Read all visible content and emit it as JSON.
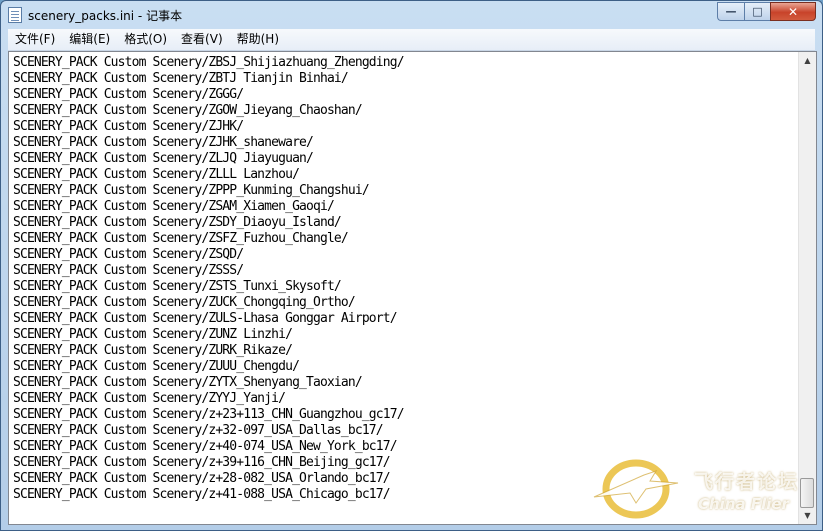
{
  "window": {
    "title": "scenery_packs.ini - 记事本",
    "buttons": {
      "minimize": "—",
      "maximize": "□",
      "close": "✕"
    }
  },
  "menu": [
    "文件(F)",
    "编辑(E)",
    "格式(O)",
    "查看(V)",
    "帮助(H)"
  ],
  "lines": [
    "SCENERY_PACK Custom Scenery/ZBSJ_Shijiazhuang_Zhengding/",
    "SCENERY_PACK Custom Scenery/ZBTJ Tianjin Binhai/",
    "SCENERY_PACK Custom Scenery/ZGGG/",
    "SCENERY_PACK Custom Scenery/ZGOW_Jieyang_Chaoshan/",
    "SCENERY_PACK Custom Scenery/ZJHK/",
    "SCENERY_PACK Custom Scenery/ZJHK_shaneware/",
    "SCENERY_PACK Custom Scenery/ZLJQ Jiayuguan/",
    "SCENERY_PACK Custom Scenery/ZLLL Lanzhou/",
    "SCENERY_PACK Custom Scenery/ZPPP_Kunming_Changshui/",
    "SCENERY_PACK Custom Scenery/ZSAM_Xiamen_Gaoqi/",
    "SCENERY_PACK Custom Scenery/ZSDY_Diaoyu_Island/",
    "SCENERY_PACK Custom Scenery/ZSFZ_Fuzhou_Changle/",
    "SCENERY_PACK Custom Scenery/ZSQD/",
    "SCENERY_PACK Custom Scenery/ZSSS/",
    "SCENERY_PACK Custom Scenery/ZSTS_Tunxi_Skysoft/",
    "SCENERY_PACK Custom Scenery/ZUCK_Chongqing_Ortho/",
    "SCENERY_PACK Custom Scenery/ZULS-Lhasa Gonggar Airport/",
    "SCENERY_PACK Custom Scenery/ZUNZ Linzhi/",
    "SCENERY_PACK Custom Scenery/ZURK_Rikaze/",
    "SCENERY_PACK Custom Scenery/ZUUU_Chengdu/",
    "SCENERY_PACK Custom Scenery/ZYTX_Shenyang_Taoxian/",
    "SCENERY_PACK Custom Scenery/ZYYJ_Yanji/",
    "SCENERY_PACK Custom Scenery/z+23+113_CHN_Guangzhou_gc17/",
    "SCENERY_PACK Custom Scenery/z+32-097_USA_Dallas_bc17/",
    "SCENERY_PACK Custom Scenery/z+40-074_USA_New_York_bc17/",
    "SCENERY_PACK Custom Scenery/z+39+116_CHN_Beijing_gc17/",
    "SCENERY_PACK Custom Scenery/z+28-082_USA_Orlando_bc17/",
    "SCENERY_PACK Custom Scenery/z+41-088_USA_Chicago_bc17/"
  ],
  "scrollbar": {
    "up": "▲",
    "down": "▼"
  },
  "watermark": {
    "cn": "飞行者论坛",
    "en": "China Flier"
  },
  "colors": {
    "text": "#000000",
    "background": "#ffffff",
    "close_button": "#c8432a",
    "watermark": "#e0b020"
  }
}
